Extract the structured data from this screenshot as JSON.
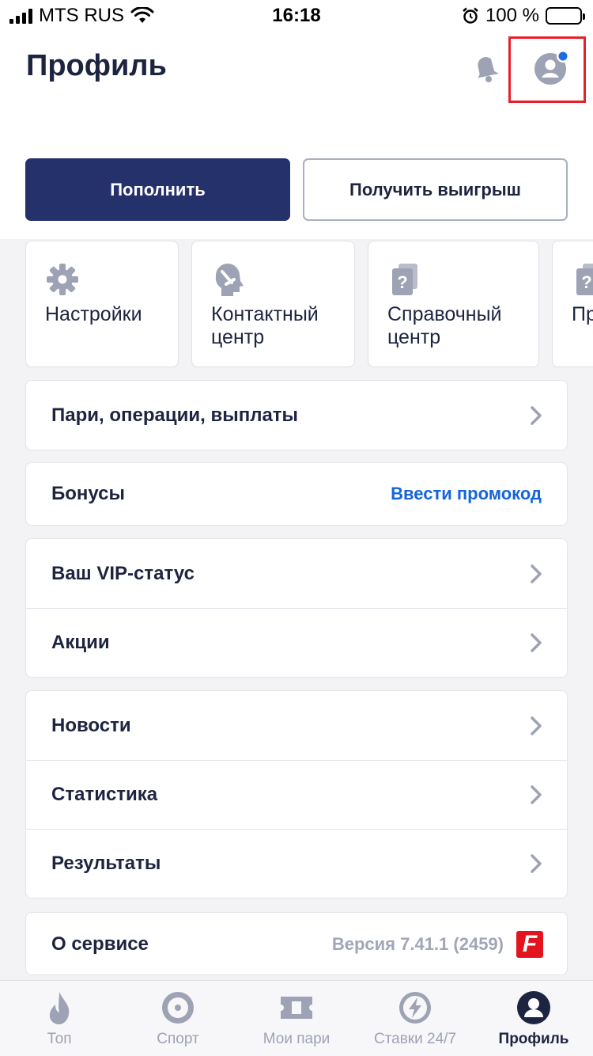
{
  "status_bar": {
    "carrier": "MTS RUS",
    "time": "16:18",
    "battery": "100 %"
  },
  "header": {
    "title": "Профиль",
    "deposit_button": "Пополнить",
    "withdraw_button": "Получить выигрыш"
  },
  "quick_tiles": [
    {
      "label": "Настройки",
      "icon": "gear-icon"
    },
    {
      "label": "Контактный центр",
      "icon": "support-head-icon"
    },
    {
      "label": "Справочный центр",
      "icon": "help-book-icon"
    },
    {
      "label": "Пр",
      "icon": "help-book-icon"
    }
  ],
  "menu": {
    "history": "Пари, операции, выплаты",
    "bonuses": "Бонусы",
    "promo_link": "Ввести промокод",
    "vip": "Ваш VIP-статус",
    "promotions": "Акции",
    "news": "Новости",
    "statistics": "Статистика",
    "results": "Результаты",
    "about": "О сервисе",
    "version": "Версия 7.41.1 (2459)",
    "brand_logo_letter": "F"
  },
  "tab_bar": {
    "items": [
      {
        "label": "Топ",
        "icon": "flame-icon"
      },
      {
        "label": "Спорт",
        "icon": "target-icon"
      },
      {
        "label": "Мои пари",
        "icon": "ticket-icon"
      },
      {
        "label": "Ставки 24/7",
        "icon": "lightning-icon"
      },
      {
        "label": "Профиль",
        "icon": "profile-icon"
      }
    ],
    "active_index": 4
  },
  "colors": {
    "primary": "#25316a",
    "accent_link": "#1565d8",
    "highlight_box": "#e8202a",
    "notification_dot": "#1a6fe0",
    "icon_gray": "#9da2b4",
    "brand_red": "#e3141f"
  }
}
